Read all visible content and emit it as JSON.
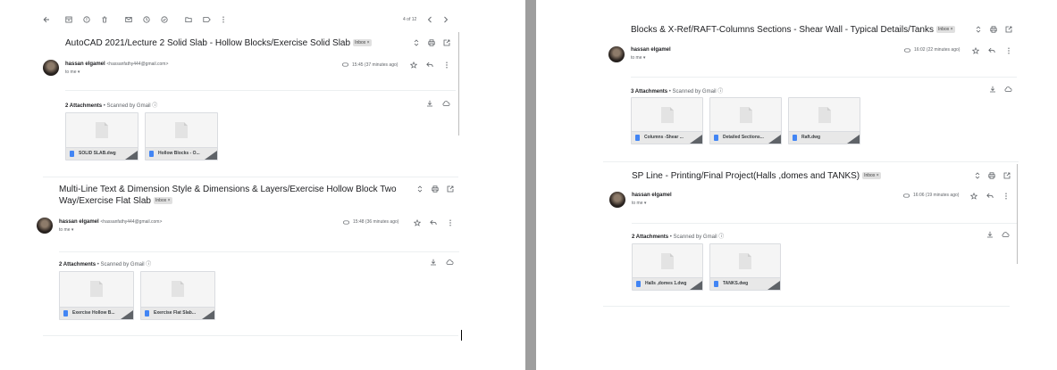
{
  "left": {
    "toolbar": {
      "icons": [
        "back-arrow-icon",
        "archive-icon",
        "report-spam-icon",
        "delete-icon",
        "mark-unread-icon",
        "snooze-icon",
        "add-task-icon",
        "move-to-icon",
        "label-icon",
        "more-vert-icon"
      ],
      "counter": "4 of 12"
    },
    "thread1": {
      "subject": "AutoCAD 2021/Lecture 2 Solid Slab - Hollow Blocks/Exercise Solid Slab",
      "badge": "Inbox ×",
      "sender_name": "hassan elgamel",
      "sender_email": "<hassanfathy444@gmail.com>",
      "to": "to me ▾",
      "time": "15:45 (37 minutes ago)",
      "attachments_count": "2 Attachments",
      "scanned": " • Scanned by Gmail ⓘ",
      "files": [
        "SOLID SLAB.dwg",
        "Hollow Blocks - O..."
      ]
    },
    "thread2": {
      "subject_line1": "Multi-Line Text & Dimension Style & Dimensions & Layers/Exercise Hollow Block Two",
      "subject_line2": "Way/Exercise Flat Slab",
      "badge": "Inbox ×",
      "sender_name": "hassan elgamel",
      "sender_email": "<hassanfathy444@gmail.com>",
      "to": "to me ▾",
      "time": "15:48 (36 minutes ago)",
      "attachments_count": "2 Attachments",
      "scanned": " • Scanned by Gmail ⓘ",
      "files": [
        "Exercise Hollow B...",
        "Exercise Flat Slab..."
      ]
    }
  },
  "right": {
    "thread1": {
      "subject": "Blocks & X-Ref/RAFT-Columns Sections - Shear Wall - Typical Details/Tanks",
      "badge": "Inbox ×",
      "sender_name": "hassan elgamel",
      "to": "to me ▾",
      "time": "16:02 (22 minutes ago)",
      "attachments_count": "3 Attachments",
      "scanned": " • Scanned by Gmail ⓘ",
      "files": [
        "Columns -Shear ...",
        "Detailed Sections...",
        "Raft.dwg"
      ]
    },
    "thread2": {
      "subject": "SP Line - Printing/Final Project(Halls ,domes and TANKS)",
      "badge": "Inbox ×",
      "sender_name": "hassan elgamel",
      "to": "to me ▾",
      "time": "16:06 (19 minutes ago)",
      "attachments_count": "2 Attachments",
      "scanned": " • Scanned by Gmail ⓘ",
      "files": [
        "Halls ,domes 1.dwg",
        "TANKS.dwg"
      ]
    }
  },
  "colors": {
    "divider": "#9e9e9e",
    "file_icon": "#4285f4",
    "badge_bg": "#e0e0e0"
  }
}
